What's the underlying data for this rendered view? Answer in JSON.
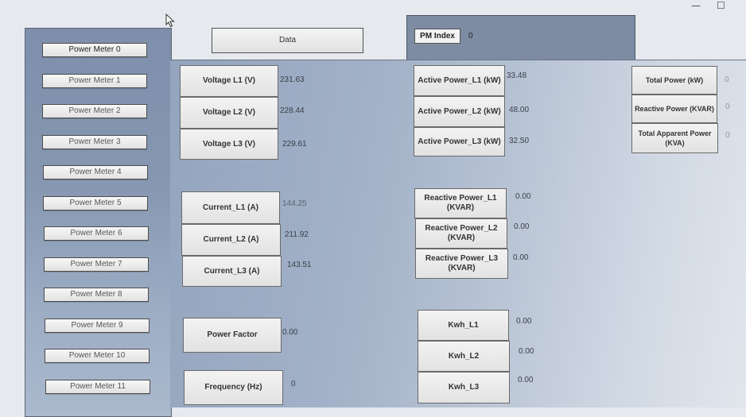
{
  "window": {
    "minimize_label": "—",
    "restore_label": "☐"
  },
  "top": {
    "data_button_label": "Data",
    "pm_index_label": "PM Index",
    "pm_index_value": "0"
  },
  "power_meters": [
    "Power Meter 0",
    "Power Meter 1",
    "Power Meter 2",
    "Power Meter 3",
    "Power Meter 4",
    "Power Meter 5",
    "Power Meter 6",
    "Power Meter 7",
    "Power Meter 8",
    "Power Meter 9",
    "Power Meter 10",
    "Power Meter 11"
  ],
  "voltage": [
    {
      "label": "Voltage L1 (V)",
      "value": "231.63"
    },
    {
      "label": "Voltage L2 (V)",
      "value": "228.44"
    },
    {
      "label": "Voltage L3 (V)",
      "value": "229.61"
    }
  ],
  "current": [
    {
      "label": "Current_L1 (A)",
      "value": "144.25"
    },
    {
      "label": "Current_L2 (A)",
      "value": "211.92"
    },
    {
      "label": "Current_L3 (A)",
      "value": "143.51"
    }
  ],
  "power_factor": {
    "label": "Power Factor",
    "value": "0.00"
  },
  "frequency": {
    "label": "Frequency (Hz)",
    "value": "0"
  },
  "active_power": [
    {
      "label": "Active Power_L1 (kW)",
      "value": "33.48"
    },
    {
      "label": "Active Power_L2 (kW)",
      "value": "48.00"
    },
    {
      "label": "Active Power_L3 (kW)",
      "value": "32.50"
    }
  ],
  "reactive_power": [
    {
      "label": "Reactive Power_L1 (KVAR)",
      "value": "0.00"
    },
    {
      "label": "Reactive Power_L2 (KVAR)",
      "value": "0.00"
    },
    {
      "label": "Reactive Power_L3 (KVAR)",
      "value": "0.00"
    }
  ],
  "kwh": [
    {
      "label": "Kwh_L1",
      "value": "0.00"
    },
    {
      "label": "Kwh_L2",
      "value": "0.00"
    },
    {
      "label": "Kwh_L3",
      "value": "0.00"
    }
  ],
  "totals": [
    {
      "label": "Total Power (kW)",
      "value": "0"
    },
    {
      "label": "Reactive Power (KVAR)",
      "value": "0"
    },
    {
      "label": "Total Apparent Power (KVA)",
      "value": "0"
    }
  ]
}
